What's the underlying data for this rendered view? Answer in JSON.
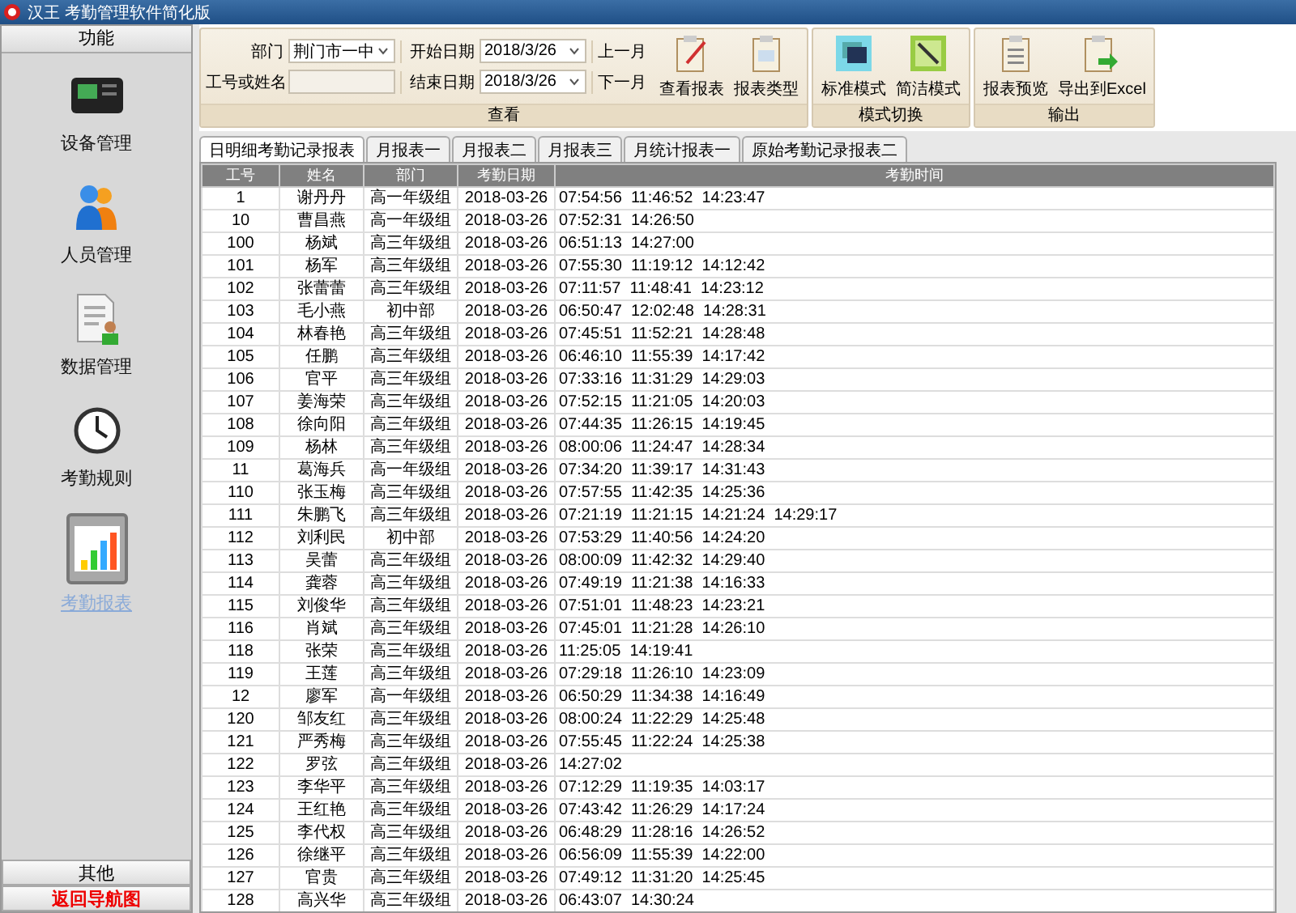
{
  "window": {
    "title": "汉王 考勤管理软件简化版"
  },
  "sidebar": {
    "header": "功能",
    "items": [
      {
        "label": "设备管理",
        "selected": false
      },
      {
        "label": "人员管理",
        "selected": false
      },
      {
        "label": "数据管理",
        "selected": false
      },
      {
        "label": "考勤规则",
        "selected": false
      },
      {
        "label": "考勤报表",
        "selected": true
      }
    ],
    "footer_buttons": [
      {
        "label": "其他",
        "kind": "normal"
      },
      {
        "label": "返回导航图",
        "kind": "alert"
      }
    ]
  },
  "ribbon": {
    "query": {
      "dept_label": "部门",
      "dept_value": "荆门市一中",
      "id_label": "工号或姓名",
      "start_label": "开始日期",
      "start_value": "2018/3/26",
      "end_label": "结束日期",
      "end_value": "2018/3/26",
      "prev": "上一月",
      "next": "下一月",
      "view": "查看报表",
      "type": "报表类型",
      "group": "查看"
    },
    "mode": {
      "standard": "标准模式",
      "simple": "简洁模式",
      "group": "模式切换"
    },
    "output": {
      "preview": "报表预览",
      "export": "导出到Excel",
      "group": "输出"
    }
  },
  "tabs": [
    {
      "label": "日明细考勤记录报表",
      "selected": true
    },
    {
      "label": "月报表一",
      "selected": false
    },
    {
      "label": "月报表二",
      "selected": false
    },
    {
      "label": "月报表三",
      "selected": false
    },
    {
      "label": "月统计报表一",
      "selected": false
    },
    {
      "label": "原始考勤记录报表二",
      "selected": false
    }
  ],
  "table": {
    "columns": [
      "工号",
      "姓名",
      "部门",
      "考勤日期",
      "考勤时间"
    ],
    "rows": [
      [
        "1",
        "谢丹丹",
        "高一年级组",
        "2018-03-26",
        "07:54:56  11:46:52  14:23:47"
      ],
      [
        "10",
        "曹昌燕",
        "高一年级组",
        "2018-03-26",
        "07:52:31  14:26:50"
      ],
      [
        "100",
        "杨斌",
        "高三年级组",
        "2018-03-26",
        "06:51:13  14:27:00"
      ],
      [
        "101",
        "杨军",
        "高三年级组",
        "2018-03-26",
        "07:55:30  11:19:12  14:12:42"
      ],
      [
        "102",
        "张蕾蕾",
        "高三年级组",
        "2018-03-26",
        "07:11:57  11:48:41  14:23:12"
      ],
      [
        "103",
        "毛小燕",
        "初中部",
        "2018-03-26",
        "06:50:47  12:02:48  14:28:31"
      ],
      [
        "104",
        "林春艳",
        "高三年级组",
        "2018-03-26",
        "07:45:51  11:52:21  14:28:48"
      ],
      [
        "105",
        "任鹏",
        "高三年级组",
        "2018-03-26",
        "06:46:10  11:55:39  14:17:42"
      ],
      [
        "106",
        "官平",
        "高三年级组",
        "2018-03-26",
        "07:33:16  11:31:29  14:29:03"
      ],
      [
        "107",
        "姜海荣",
        "高三年级组",
        "2018-03-26",
        "07:52:15  11:21:05  14:20:03"
      ],
      [
        "108",
        "徐向阳",
        "高三年级组",
        "2018-03-26",
        "07:44:35  11:26:15  14:19:45"
      ],
      [
        "109",
        "杨林",
        "高三年级组",
        "2018-03-26",
        "08:00:06  11:24:47  14:28:34"
      ],
      [
        "11",
        "葛海兵",
        "高一年级组",
        "2018-03-26",
        "07:34:20  11:39:17  14:31:43"
      ],
      [
        "110",
        "张玉梅",
        "高三年级组",
        "2018-03-26",
        "07:57:55  11:42:35  14:25:36"
      ],
      [
        "111",
        "朱鹏飞",
        "高三年级组",
        "2018-03-26",
        "07:21:19  11:21:15  14:21:24  14:29:17"
      ],
      [
        "112",
        "刘利民",
        "初中部",
        "2018-03-26",
        "07:53:29  11:40:56  14:24:20"
      ],
      [
        "113",
        "吴蕾",
        "高三年级组",
        "2018-03-26",
        "08:00:09  11:42:32  14:29:40"
      ],
      [
        "114",
        "龚蓉",
        "高三年级组",
        "2018-03-26",
        "07:49:19  11:21:38  14:16:33"
      ],
      [
        "115",
        "刘俊华",
        "高三年级组",
        "2018-03-26",
        "07:51:01  11:48:23  14:23:21"
      ],
      [
        "116",
        "肖斌",
        "高三年级组",
        "2018-03-26",
        "07:45:01  11:21:28  14:26:10"
      ],
      [
        "118",
        "张荣",
        "高三年级组",
        "2018-03-26",
        "11:25:05  14:19:41"
      ],
      [
        "119",
        "王莲",
        "高三年级组",
        "2018-03-26",
        "07:29:18  11:26:10  14:23:09"
      ],
      [
        "12",
        "廖军",
        "高一年级组",
        "2018-03-26",
        "06:50:29  11:34:38  14:16:49"
      ],
      [
        "120",
        "邹友红",
        "高三年级组",
        "2018-03-26",
        "08:00:24  11:22:29  14:25:48"
      ],
      [
        "121",
        "严秀梅",
        "高三年级组",
        "2018-03-26",
        "07:55:45  11:22:24  14:25:38"
      ],
      [
        "122",
        "罗弦",
        "高三年级组",
        "2018-03-26",
        "14:27:02"
      ],
      [
        "123",
        "李华平",
        "高三年级组",
        "2018-03-26",
        "07:12:29  11:19:35  14:03:17"
      ],
      [
        "124",
        "王红艳",
        "高三年级组",
        "2018-03-26",
        "07:43:42  11:26:29  14:17:24"
      ],
      [
        "125",
        "李代权",
        "高三年级组",
        "2018-03-26",
        "06:48:29  11:28:16  14:26:52"
      ],
      [
        "126",
        "徐继平",
        "高三年级组",
        "2018-03-26",
        "06:56:09  11:55:39  14:22:00"
      ],
      [
        "127",
        "官贵",
        "高三年级组",
        "2018-03-26",
        "07:49:12  11:31:20  14:25:45"
      ],
      [
        "128",
        "高兴华",
        "高三年级组",
        "2018-03-26",
        "06:43:07  14:30:24"
      ]
    ]
  }
}
